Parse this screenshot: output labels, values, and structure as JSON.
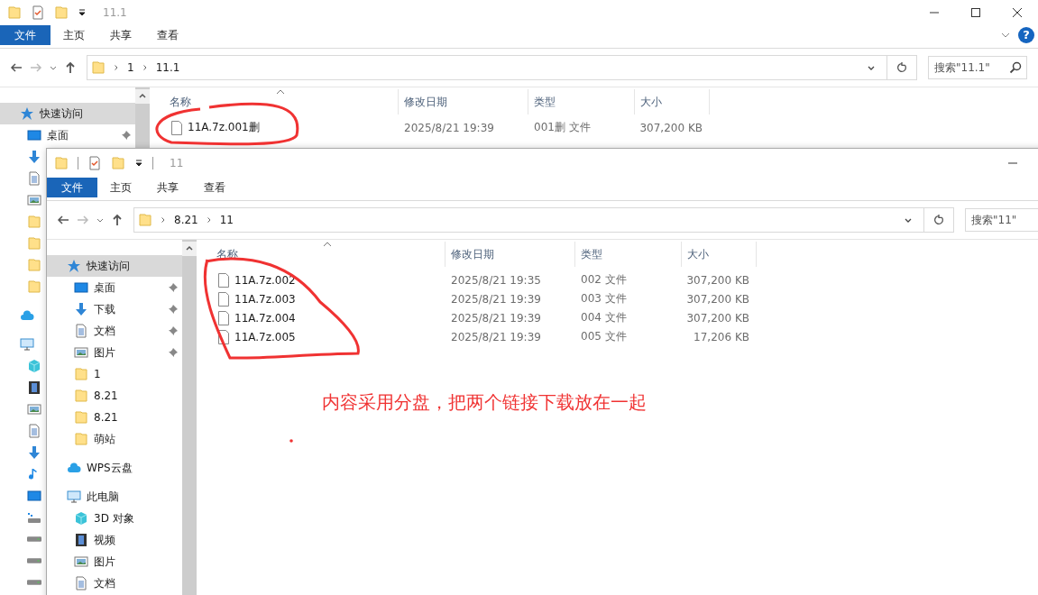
{
  "windows": [
    {
      "title": "11.1",
      "help_button": "?",
      "ribbon_tabs": [
        {
          "label": "文件",
          "kind": "file-menu"
        },
        {
          "label": "主页",
          "kind": "tab"
        },
        {
          "label": "共享",
          "kind": "tab"
        },
        {
          "label": "查看",
          "kind": "tab"
        }
      ],
      "breadcrumb": [
        "1",
        "11.1"
      ],
      "search": {
        "placeholder": "搜索\"11.1\""
      },
      "nav": [
        {
          "label": "快速访问",
          "kind": "star",
          "selected": true,
          "children": [
            {
              "label": "桌面",
              "kind": "desktop",
              "selected": false,
              "pinned": true
            },
            {
              "kind": "download",
              "selected": false
            },
            {
              "kind": "doc",
              "selected": false
            },
            {
              "kind": "picture",
              "selected": false
            },
            {
              "kind": "folder",
              "selected": false
            },
            {
              "kind": "folder",
              "selected": false
            },
            {
              "kind": "folder",
              "selected": false
            },
            {
              "kind": "folder",
              "selected": false
            }
          ]
        },
        {
          "kind": "cloud",
          "selected": false
        },
        {
          "kind": "pc",
          "selected": false,
          "children": [
            {
              "kind": "cube",
              "selected": false
            },
            {
              "kind": "video",
              "selected": false
            },
            {
              "kind": "picture",
              "selected": false
            },
            {
              "kind": "doc",
              "selected": false
            },
            {
              "kind": "download",
              "selected": false
            },
            {
              "kind": "music",
              "selected": false
            },
            {
              "kind": "desktop",
              "selected": false
            },
            {
              "kind": "netdrive",
              "selected": false
            },
            {
              "kind": "drive",
              "selected": false
            },
            {
              "kind": "drive",
              "selected": false
            },
            {
              "kind": "drive",
              "selected": false
            }
          ]
        }
      ],
      "table": {
        "columns": [
          "名称",
          "修改日期",
          "类型",
          "大小"
        ],
        "rows": [
          {
            "name": "11A.7z.001删",
            "modified": "2025/8/21 19:39",
            "type": "001删 文件",
            "size": "307,200 KB"
          }
        ]
      }
    },
    {
      "title": "11",
      "ribbon_tabs": [
        {
          "label": "文件",
          "kind": "file-menu"
        },
        {
          "label": "主页",
          "kind": "tab"
        },
        {
          "label": "共享",
          "kind": "tab"
        },
        {
          "label": "查看",
          "kind": "tab"
        }
      ],
      "breadcrumb": [
        "8.21",
        "11"
      ],
      "search": {
        "placeholder": "搜索\"11\""
      },
      "nav": [
        {
          "label": "快速访问",
          "kind": "star",
          "selected": true,
          "children": [
            {
              "label": "桌面",
              "kind": "desktop",
              "selected": false,
              "pinned": true
            },
            {
              "label": "下载",
              "kind": "download",
              "selected": false,
              "pinned": true
            },
            {
              "label": "文档",
              "kind": "doc",
              "selected": false,
              "pinned": true
            },
            {
              "label": "图片",
              "kind": "picture",
              "selected": false,
              "pinned": true
            },
            {
              "label": "1",
              "kind": "folder",
              "selected": false,
              "pinned": false
            },
            {
              "label": "8.21",
              "kind": "folder",
              "selected": false,
              "pinned": false
            },
            {
              "label": "8.21",
              "kind": "folder",
              "selected": false,
              "pinned": false
            },
            {
              "label": "萌站",
              "kind": "folder",
              "selected": false,
              "pinned": false
            }
          ]
        },
        {
          "label": "WPS云盘",
          "kind": "cloud",
          "selected": false
        },
        {
          "label": "此电脑",
          "kind": "pc",
          "selected": false,
          "children": [
            {
              "label": "3D 对象",
              "kind": "cube",
              "selected": false
            },
            {
              "label": "视频",
              "kind": "video",
              "selected": false
            },
            {
              "label": "图片",
              "kind": "picture",
              "selected": false
            },
            {
              "label": "文档",
              "kind": "doc",
              "selected": false
            }
          ]
        }
      ],
      "table": {
        "columns": [
          "名称",
          "修改日期",
          "类型",
          "大小"
        ],
        "rows": [
          {
            "name": "11A.7z.002",
            "modified": "2025/8/21 19:35",
            "type": "002 文件",
            "size": "307,200 KB"
          },
          {
            "name": "11A.7z.003",
            "modified": "2025/8/21 19:39",
            "type": "003 文件",
            "size": "307,200 KB"
          },
          {
            "name": "11A.7z.004",
            "modified": "2025/8/21 19:39",
            "type": "004 文件",
            "size": "307,200 KB"
          },
          {
            "name": "11A.7z.005",
            "modified": "2025/8/21 19:39",
            "type": "005 文件",
            "size": "17,206 KB"
          }
        ]
      }
    }
  ],
  "annotation": {
    "note": "内容采用分盘，把两个链接下载放在一起"
  }
}
